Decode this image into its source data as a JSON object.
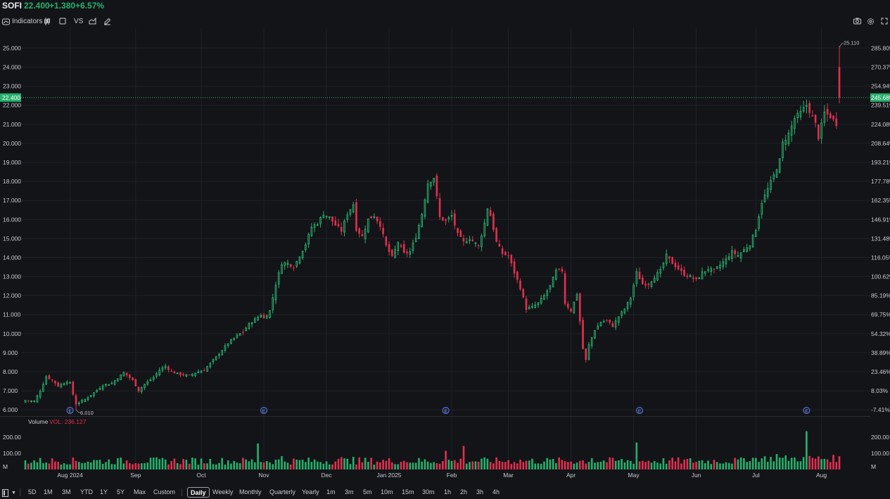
{
  "header": {
    "symbol": "SOFI",
    "price": "22.400",
    "change": "+1.380",
    "change_pct": "+6.57%"
  },
  "toolbar": {
    "indicators_label": "Indicators",
    "compare_label": "VS"
  },
  "colors": {
    "up": "#26b06c",
    "down": "#e0304e",
    "bg": "#131418",
    "grid": "#1f2127",
    "text": "#c9ccd3"
  },
  "volume_panel": {
    "label": "Volume",
    "value_label": "VOL: 236.127",
    "y_ticks": [
      "200.00",
      "100.00",
      "M"
    ]
  },
  "timeframes": {
    "ranges": [
      "5D",
      "1M",
      "3M",
      "YTD",
      "1Y",
      "5Y",
      "Max",
      "Custom"
    ],
    "intervals": [
      "Daily",
      "Weekly",
      "Monthly",
      "Quarterly",
      "Yearly",
      "1m",
      "3m",
      "5m",
      "10m",
      "15m",
      "30m",
      "1h",
      "2h",
      "3h",
      "4h"
    ],
    "active": "Daily"
  },
  "chart_data": {
    "type": "candlestick",
    "symbol": "SOFI",
    "y_ticks": [
      "25.000",
      "24.000",
      "23.000",
      "22.000",
      "21.000",
      "20.000",
      "19.000",
      "18.000",
      "17.000",
      "16.000",
      "15.000",
      "14.000",
      "13.000",
      "12.000",
      "11.000",
      "10.000",
      "9.000",
      "8.000",
      "7.000",
      "6.000"
    ],
    "y_right_ticks": [
      "285.80%",
      "270.37%",
      "254.94%",
      "239.51%",
      "224.08%",
      "208.64%",
      "193.21%",
      "177.78%",
      "162.35%",
      "146.91%",
      "131.48%",
      "116.05%",
      "100.62%",
      "85.19%",
      "69.75%",
      "54.32%",
      "38.89%",
      "23.46%",
      "8.03%",
      "-7.41%"
    ],
    "ylim": [
      5.75,
      25.9
    ],
    "x_labels": [
      {
        "label": "Aug 2024",
        "i": 15
      },
      {
        "label": "Sep",
        "i": 37
      },
      {
        "label": "Oct",
        "i": 59
      },
      {
        "label": "Nov",
        "i": 80
      },
      {
        "label": "Dec",
        "i": 101
      },
      {
        "label": "Jan 2025",
        "i": 122
      },
      {
        "label": "Feb",
        "i": 143
      },
      {
        "label": "Mar",
        "i": 162
      },
      {
        "label": "Apr",
        "i": 183
      },
      {
        "label": "May",
        "i": 204
      },
      {
        "label": "Jun",
        "i": 225
      },
      {
        "label": "Jul",
        "i": 245
      },
      {
        "label": "Aug",
        "i": 267
      }
    ],
    "last_price": "22.400",
    "last_price_pct": "245.68%",
    "high_annotation": {
      "label": "25.110",
      "value": 25.11
    },
    "low_annotation": {
      "label": "6.010",
      "value": 6.01
    },
    "earnings_markers": [
      {
        "i": 15,
        "label": "E"
      },
      {
        "i": 80,
        "label": "E"
      },
      {
        "i": 141,
        "label": "E"
      },
      {
        "i": 206,
        "label": "E"
      },
      {
        "i": 262,
        "label": "E"
      }
    ],
    "anchors": [
      [
        0,
        6.5
      ],
      [
        3,
        6.45
      ],
      [
        5,
        7.0
      ],
      [
        7,
        7.75
      ],
      [
        9,
        7.55
      ],
      [
        11,
        7.25
      ],
      [
        14,
        7.5
      ],
      [
        15,
        7.4
      ],
      [
        16,
        6.8
      ],
      [
        17,
        6.3
      ],
      [
        20,
        6.55
      ],
      [
        23,
        6.9
      ],
      [
        26,
        7.3
      ],
      [
        29,
        7.4
      ],
      [
        33,
        7.95
      ],
      [
        36,
        7.55
      ],
      [
        38,
        7.0
      ],
      [
        40,
        7.35
      ],
      [
        43,
        7.7
      ],
      [
        45,
        8.1
      ],
      [
        47,
        8.3
      ],
      [
        49,
        8.0
      ],
      [
        52,
        7.85
      ],
      [
        55,
        7.8
      ],
      [
        57,
        7.95
      ],
      [
        60,
        8.1
      ],
      [
        63,
        8.6
      ],
      [
        65,
        8.95
      ],
      [
        68,
        9.5
      ],
      [
        71,
        9.9
      ],
      [
        73,
        10.1
      ],
      [
        75,
        10.5
      ],
      [
        77,
        10.75
      ],
      [
        79,
        11.0
      ],
      [
        80,
        10.8
      ],
      [
        82,
        11.2
      ],
      [
        84,
        12.6
      ],
      [
        86,
        13.7
      ],
      [
        88,
        13.7
      ],
      [
        90,
        13.5
      ],
      [
        92,
        14.1
      ],
      [
        94,
        14.7
      ],
      [
        96,
        15.6
      ],
      [
        98,
        15.8
      ],
      [
        100,
        16.3
      ],
      [
        102,
        16.1
      ],
      [
        104,
        15.7
      ],
      [
        106,
        15.4
      ],
      [
        108,
        16.3
      ],
      [
        110,
        16.8
      ],
      [
        111,
        15.5
      ],
      [
        113,
        15.1
      ],
      [
        115,
        16.0
      ],
      [
        117,
        16.2
      ],
      [
        119,
        15.7
      ],
      [
        121,
        14.6
      ],
      [
        123,
        14.0
      ],
      [
        125,
        14.8
      ],
      [
        127,
        14.2
      ],
      [
        129,
        14.3
      ],
      [
        131,
        15.1
      ],
      [
        133,
        16.3
      ],
      [
        135,
        17.9
      ],
      [
        137,
        18.2
      ],
      [
        139,
        16.1
      ],
      [
        141,
        15.9
      ],
      [
        143,
        16.2
      ],
      [
        145,
        15.2
      ],
      [
        147,
        14.8
      ],
      [
        149,
        15.0
      ],
      [
        152,
        14.6
      ],
      [
        154,
        15.8
      ],
      [
        155,
        16.6
      ],
      [
        156,
        16.2
      ],
      [
        158,
        14.8
      ],
      [
        160,
        14.2
      ],
      [
        162,
        14.1
      ],
      [
        164,
        13.2
      ],
      [
        166,
        12.4
      ],
      [
        168,
        11.3
      ],
      [
        170,
        11.4
      ],
      [
        172,
        11.6
      ],
      [
        174,
        12.0
      ],
      [
        176,
        12.5
      ],
      [
        178,
        13.3
      ],
      [
        180,
        13.3
      ],
      [
        181,
        11.6
      ],
      [
        183,
        11.2
      ],
      [
        185,
        12.1
      ],
      [
        187,
        9.2
      ],
      [
        188,
        8.6
      ],
      [
        189,
        9.4
      ],
      [
        191,
        10.2
      ],
      [
        193,
        10.6
      ],
      [
        195,
        10.7
      ],
      [
        197,
        10.4
      ],
      [
        199,
        10.9
      ],
      [
        201,
        11.3
      ],
      [
        203,
        11.9
      ],
      [
        205,
        13.2
      ],
      [
        207,
        12.6
      ],
      [
        209,
        12.6
      ],
      [
        211,
        13.0
      ],
      [
        213,
        13.3
      ],
      [
        215,
        14.1
      ],
      [
        217,
        13.7
      ],
      [
        219,
        13.4
      ],
      [
        221,
        13.1
      ],
      [
        223,
        13.0
      ],
      [
        225,
        12.8
      ],
      [
        227,
        13.2
      ],
      [
        229,
        13.4
      ],
      [
        231,
        13.3
      ],
      [
        233,
        13.6
      ],
      [
        235,
        13.9
      ],
      [
        237,
        14.3
      ],
      [
        239,
        14.1
      ],
      [
        241,
        14.4
      ],
      [
        243,
        14.7
      ],
      [
        245,
        15.5
      ],
      [
        247,
        16.9
      ],
      [
        249,
        17.6
      ],
      [
        251,
        18.3
      ],
      [
        253,
        19.1
      ],
      [
        254,
        20.0
      ],
      [
        256,
        20.5
      ],
      [
        258,
        21.3
      ],
      [
        260,
        21.6
      ],
      [
        262,
        22.0
      ],
      [
        263,
        21.7
      ],
      [
        265,
        21.0
      ],
      [
        266,
        20.3
      ],
      [
        268,
        21.6
      ],
      [
        270,
        21.4
      ],
      [
        272,
        21.02
      ],
      [
        273,
        22.4
      ]
    ],
    "candles_count": 274,
    "last_candle": {
      "open": 24.0,
      "high": 25.11,
      "low": 22.1,
      "close": 22.4
    },
    "volume_ylim": [
      0,
      260
    ]
  }
}
